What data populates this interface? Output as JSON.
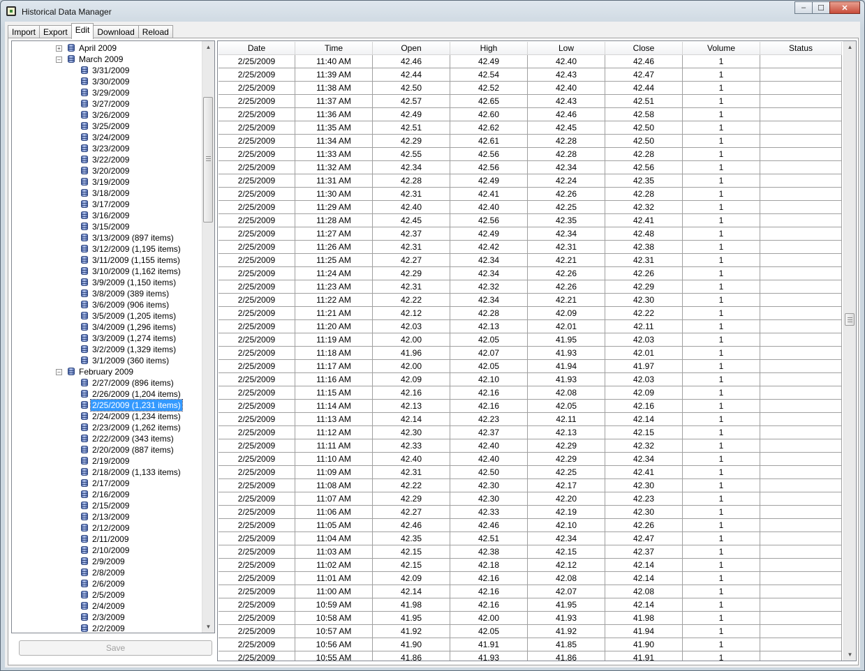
{
  "window": {
    "title": "Historical Data Manager",
    "minimize": "–",
    "maximize": "☐",
    "close": "✕"
  },
  "tabs": [
    "Import",
    "Export",
    "Edit",
    "Download",
    "Reload"
  ],
  "active_tab": "Edit",
  "tree": {
    "expand_glyph": "+",
    "collapse_glyph": "–",
    "scroll_up": "▲",
    "scroll_down": "▼",
    "nodes": [
      {
        "label": "April 2009",
        "level": 1,
        "state": "collapsed"
      },
      {
        "label": "March 2009",
        "level": 1,
        "state": "expanded"
      },
      {
        "label": "3/31/2009",
        "level": 2
      },
      {
        "label": "3/30/2009",
        "level": 2
      },
      {
        "label": "3/29/2009",
        "level": 2
      },
      {
        "label": "3/27/2009",
        "level": 2
      },
      {
        "label": "3/26/2009",
        "level": 2
      },
      {
        "label": "3/25/2009",
        "level": 2
      },
      {
        "label": "3/24/2009",
        "level": 2
      },
      {
        "label": "3/23/2009",
        "level": 2
      },
      {
        "label": "3/22/2009",
        "level": 2
      },
      {
        "label": "3/20/2009",
        "level": 2
      },
      {
        "label": "3/19/2009",
        "level": 2
      },
      {
        "label": "3/18/2009",
        "level": 2
      },
      {
        "label": "3/17/2009",
        "level": 2
      },
      {
        "label": "3/16/2009",
        "level": 2
      },
      {
        "label": "3/15/2009",
        "level": 2
      },
      {
        "label": "3/13/2009 (897 items)",
        "level": 2
      },
      {
        "label": "3/12/2009 (1,195 items)",
        "level": 2
      },
      {
        "label": "3/11/2009 (1,155 items)",
        "level": 2
      },
      {
        "label": "3/10/2009 (1,162 items)",
        "level": 2
      },
      {
        "label": "3/9/2009 (1,150 items)",
        "level": 2
      },
      {
        "label": "3/8/2009 (389 items)",
        "level": 2
      },
      {
        "label": "3/6/2009 (906 items)",
        "level": 2
      },
      {
        "label": "3/5/2009 (1,205 items)",
        "level": 2
      },
      {
        "label": "3/4/2009 (1,296 items)",
        "level": 2
      },
      {
        "label": "3/3/2009 (1,274 items)",
        "level": 2
      },
      {
        "label": "3/2/2009 (1,329 items)",
        "level": 2
      },
      {
        "label": "3/1/2009 (360 items)",
        "level": 2
      },
      {
        "label": "February 2009",
        "level": 1,
        "state": "expanded"
      },
      {
        "label": "2/27/2009 (896 items)",
        "level": 2
      },
      {
        "label": "2/26/2009 (1,204 items)",
        "level": 2
      },
      {
        "label": "2/25/2009 (1,231 items)",
        "level": 2,
        "selected": true
      },
      {
        "label": "2/24/2009 (1,234 items)",
        "level": 2
      },
      {
        "label": "2/23/2009 (1,262 items)",
        "level": 2
      },
      {
        "label": "2/22/2009 (343 items)",
        "level": 2
      },
      {
        "label": "2/20/2009 (887 items)",
        "level": 2
      },
      {
        "label": "2/19/2009",
        "level": 2
      },
      {
        "label": "2/18/2009 (1,133 items)",
        "level": 2
      },
      {
        "label": "2/17/2009",
        "level": 2
      },
      {
        "label": "2/16/2009",
        "level": 2
      },
      {
        "label": "2/15/2009",
        "level": 2
      },
      {
        "label": "2/13/2009",
        "level": 2
      },
      {
        "label": "2/12/2009",
        "level": 2
      },
      {
        "label": "2/11/2009",
        "level": 2
      },
      {
        "label": "2/10/2009",
        "level": 2
      },
      {
        "label": "2/9/2009",
        "level": 2
      },
      {
        "label": "2/8/2009",
        "level": 2
      },
      {
        "label": "2/6/2009",
        "level": 2
      },
      {
        "label": "2/5/2009",
        "level": 2
      },
      {
        "label": "2/4/2009",
        "level": 2
      },
      {
        "label": "2/3/2009",
        "level": 2
      },
      {
        "label": "2/2/2009",
        "level": 2
      }
    ]
  },
  "save_button": "Save",
  "grid": {
    "scroll_up": "▲",
    "scroll_down": "▼",
    "columns": [
      "Date",
      "Time",
      "Open",
      "High",
      "Low",
      "Close",
      "Volume",
      "Status"
    ],
    "rows": [
      [
        "2/25/2009",
        "11:40 AM",
        "42.46",
        "42.49",
        "42.40",
        "42.46",
        "1",
        ""
      ],
      [
        "2/25/2009",
        "11:39 AM",
        "42.44",
        "42.54",
        "42.43",
        "42.47",
        "1",
        ""
      ],
      [
        "2/25/2009",
        "11:38 AM",
        "42.50",
        "42.52",
        "42.40",
        "42.44",
        "1",
        ""
      ],
      [
        "2/25/2009",
        "11:37 AM",
        "42.57",
        "42.65",
        "42.43",
        "42.51",
        "1",
        ""
      ],
      [
        "2/25/2009",
        "11:36 AM",
        "42.49",
        "42.60",
        "42.46",
        "42.58",
        "1",
        ""
      ],
      [
        "2/25/2009",
        "11:35 AM",
        "42.51",
        "42.62",
        "42.45",
        "42.50",
        "1",
        ""
      ],
      [
        "2/25/2009",
        "11:34 AM",
        "42.29",
        "42.61",
        "42.28",
        "42.50",
        "1",
        ""
      ],
      [
        "2/25/2009",
        "11:33 AM",
        "42.55",
        "42.56",
        "42.28",
        "42.28",
        "1",
        ""
      ],
      [
        "2/25/2009",
        "11:32 AM",
        "42.34",
        "42.56",
        "42.34",
        "42.56",
        "1",
        ""
      ],
      [
        "2/25/2009",
        "11:31 AM",
        "42.28",
        "42.49",
        "42.24",
        "42.35",
        "1",
        ""
      ],
      [
        "2/25/2009",
        "11:30 AM",
        "42.31",
        "42.41",
        "42.26",
        "42.28",
        "1",
        ""
      ],
      [
        "2/25/2009",
        "11:29 AM",
        "42.40",
        "42.40",
        "42.25",
        "42.32",
        "1",
        ""
      ],
      [
        "2/25/2009",
        "11:28 AM",
        "42.45",
        "42.56",
        "42.35",
        "42.41",
        "1",
        ""
      ],
      [
        "2/25/2009",
        "11:27 AM",
        "42.37",
        "42.49",
        "42.34",
        "42.48",
        "1",
        ""
      ],
      [
        "2/25/2009",
        "11:26 AM",
        "42.31",
        "42.42",
        "42.31",
        "42.38",
        "1",
        ""
      ],
      [
        "2/25/2009",
        "11:25 AM",
        "42.27",
        "42.34",
        "42.21",
        "42.31",
        "1",
        ""
      ],
      [
        "2/25/2009",
        "11:24 AM",
        "42.29",
        "42.34",
        "42.26",
        "42.26",
        "1",
        ""
      ],
      [
        "2/25/2009",
        "11:23 AM",
        "42.31",
        "42.32",
        "42.26",
        "42.29",
        "1",
        ""
      ],
      [
        "2/25/2009",
        "11:22 AM",
        "42.22",
        "42.34",
        "42.21",
        "42.30",
        "1",
        ""
      ],
      [
        "2/25/2009",
        "11:21 AM",
        "42.12",
        "42.28",
        "42.09",
        "42.22",
        "1",
        ""
      ],
      [
        "2/25/2009",
        "11:20 AM",
        "42.03",
        "42.13",
        "42.01",
        "42.11",
        "1",
        ""
      ],
      [
        "2/25/2009",
        "11:19 AM",
        "42.00",
        "42.05",
        "41.95",
        "42.03",
        "1",
        ""
      ],
      [
        "2/25/2009",
        "11:18 AM",
        "41.96",
        "42.07",
        "41.93",
        "42.01",
        "1",
        ""
      ],
      [
        "2/25/2009",
        "11:17 AM",
        "42.00",
        "42.05",
        "41.94",
        "41.97",
        "1",
        ""
      ],
      [
        "2/25/2009",
        "11:16 AM",
        "42.09",
        "42.10",
        "41.93",
        "42.03",
        "1",
        ""
      ],
      [
        "2/25/2009",
        "11:15 AM",
        "42.16",
        "42.16",
        "42.08",
        "42.09",
        "1",
        ""
      ],
      [
        "2/25/2009",
        "11:14 AM",
        "42.13",
        "42.16",
        "42.05",
        "42.16",
        "1",
        ""
      ],
      [
        "2/25/2009",
        "11:13 AM",
        "42.14",
        "42.23",
        "42.11",
        "42.14",
        "1",
        ""
      ],
      [
        "2/25/2009",
        "11:12 AM",
        "42.30",
        "42.37",
        "42.13",
        "42.15",
        "1",
        ""
      ],
      [
        "2/25/2009",
        "11:11 AM",
        "42.33",
        "42.40",
        "42.29",
        "42.32",
        "1",
        ""
      ],
      [
        "2/25/2009",
        "11:10 AM",
        "42.40",
        "42.40",
        "42.29",
        "42.34",
        "1",
        ""
      ],
      [
        "2/25/2009",
        "11:09 AM",
        "42.31",
        "42.50",
        "42.25",
        "42.41",
        "1",
        ""
      ],
      [
        "2/25/2009",
        "11:08 AM",
        "42.22",
        "42.30",
        "42.17",
        "42.30",
        "1",
        ""
      ],
      [
        "2/25/2009",
        "11:07 AM",
        "42.29",
        "42.30",
        "42.20",
        "42.23",
        "1",
        ""
      ],
      [
        "2/25/2009",
        "11:06 AM",
        "42.27",
        "42.33",
        "42.19",
        "42.30",
        "1",
        ""
      ],
      [
        "2/25/2009",
        "11:05 AM",
        "42.46",
        "42.46",
        "42.10",
        "42.26",
        "1",
        ""
      ],
      [
        "2/25/2009",
        "11:04 AM",
        "42.35",
        "42.51",
        "42.34",
        "42.47",
        "1",
        ""
      ],
      [
        "2/25/2009",
        "11:03 AM",
        "42.15",
        "42.38",
        "42.15",
        "42.37",
        "1",
        ""
      ],
      [
        "2/25/2009",
        "11:02 AM",
        "42.15",
        "42.18",
        "42.12",
        "42.14",
        "1",
        ""
      ],
      [
        "2/25/2009",
        "11:01 AM",
        "42.09",
        "42.16",
        "42.08",
        "42.14",
        "1",
        ""
      ],
      [
        "2/25/2009",
        "11:00 AM",
        "42.14",
        "42.16",
        "42.07",
        "42.08",
        "1",
        ""
      ],
      [
        "2/25/2009",
        "10:59 AM",
        "41.98",
        "42.16",
        "41.95",
        "42.14",
        "1",
        ""
      ],
      [
        "2/25/2009",
        "10:58 AM",
        "41.95",
        "42.00",
        "41.93",
        "41.98",
        "1",
        ""
      ],
      [
        "2/25/2009",
        "10:57 AM",
        "41.92",
        "42.05",
        "41.92",
        "41.94",
        "1",
        ""
      ],
      [
        "2/25/2009",
        "10:56 AM",
        "41.90",
        "41.91",
        "41.85",
        "41.90",
        "1",
        ""
      ],
      [
        "2/25/2009",
        "10:55 AM",
        "41.86",
        "41.93",
        "41.86",
        "41.91",
        "1",
        ""
      ]
    ]
  }
}
